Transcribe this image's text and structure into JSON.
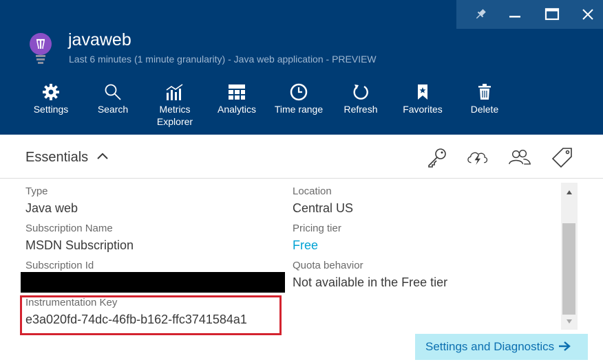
{
  "app": {
    "title": "javaweb",
    "subtitle": "Last 6 minutes (1 minute granularity) - Java web application - PREVIEW",
    "icon": "lightbulb-icon"
  },
  "window_controls": [
    {
      "name": "pin-icon"
    },
    {
      "name": "minimize-icon"
    },
    {
      "name": "maximize-icon"
    },
    {
      "name": "close-icon"
    }
  ],
  "toolbar": {
    "settings": "Settings",
    "search": "Search",
    "metrics_line1": "Metrics",
    "metrics_line2": "Explorer",
    "analytics": "Analytics",
    "time_range": "Time range",
    "refresh": "Refresh",
    "favorites": "Favorites",
    "delete": "Delete"
  },
  "essentials": {
    "title": "Essentials",
    "icons": [
      "key-icon",
      "cloud-lightning-icon",
      "users-icon",
      "tag-icon"
    ]
  },
  "fields": {
    "type_label": "Type",
    "type_value": "Java web",
    "subscription_name_label": "Subscription Name",
    "subscription_name_value": "MSDN Subscription",
    "subscription_id_label": "Subscription Id",
    "instrumentation_key_label": "Instrumentation Key",
    "instrumentation_key_value": "e3a020fd-74dc-46fb-b162-ffc3741584a1",
    "location_label": "Location",
    "location_value": "Central US",
    "pricing_tier_label": "Pricing tier",
    "pricing_tier_value": "Free",
    "quota_label": "Quota behavior",
    "quota_value": "Not available in the Free tier"
  },
  "footer": {
    "settings_diagnostics": "Settings and Diagnostics"
  },
  "colors": {
    "header_bg": "#003c74",
    "link": "#00a2d4",
    "highlight_border": "#d3232f",
    "button_bg": "#b9ecf6"
  }
}
